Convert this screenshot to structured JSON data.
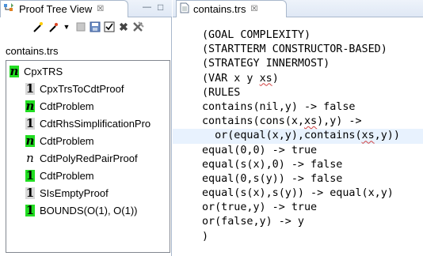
{
  "proof_view": {
    "tab_title": "Proof Tree View",
    "close_glyph": "☒",
    "minimize_glyph": "—",
    "maximize_glyph": "□",
    "file_label": "contains.trs",
    "tree": [
      {
        "badge": "n",
        "badge_style": "n-green",
        "label": "CpxTRS"
      },
      {
        "badge": "1",
        "badge_style": "1-gray",
        "label": "CpxTrsToCdtProof"
      },
      {
        "badge": "n",
        "badge_style": "n-green",
        "label": "CdtProblem"
      },
      {
        "badge": "1",
        "badge_style": "1-gray",
        "label": "CdtRhsSimplificationPro"
      },
      {
        "badge": "n",
        "badge_style": "n-green",
        "label": "CdtProblem"
      },
      {
        "badge": "n",
        "badge_style": "n-plain",
        "label": "CdtPolyRedPairProof"
      },
      {
        "badge": "1",
        "badge_style": "1-green",
        "label": "CdtProblem"
      },
      {
        "badge": "1",
        "badge_style": "1-gray",
        "label": "SIsEmptyProof"
      },
      {
        "badge": "1",
        "badge_style": "1-green",
        "label": "BOUNDS(O(1), O(1))"
      }
    ],
    "toolbar_icons": [
      "wand-icon",
      "wand-dropdown-icon",
      "dropdown-arrow-icon",
      "stop-icon",
      "save-icon",
      "checkbox-icon",
      "close-x-icon",
      "clear-all-icon"
    ]
  },
  "editor": {
    "tab_title": "contains.trs",
    "close_glyph": "☒",
    "lines": [
      "(GOAL COMPLEXITY)",
      "(STARTTERM CONSTRUCTOR-BASED)",
      "(STRATEGY INNERMOST)",
      "(VAR x y xs)",
      "(RULES",
      "contains(nil,y) -> false",
      "contains(cons(x,xs),y) ->",
      "  or(equal(x,y),contains(xs,y))",
      "equal(0,0) -> true",
      "equal(s(x),0) -> false",
      "equal(0,s(y)) -> false",
      "equal(s(x),s(y)) -> equal(x,y)",
      "or(true,y) -> true",
      "or(false,y) -> y",
      ")"
    ],
    "highlighted_line": 7
  },
  "colors": {
    "badge_green": "#22dd22",
    "badge_gray": "#d8d8d8",
    "tab_border": "#a9b8cc",
    "current_line": "#e8f2fe"
  }
}
